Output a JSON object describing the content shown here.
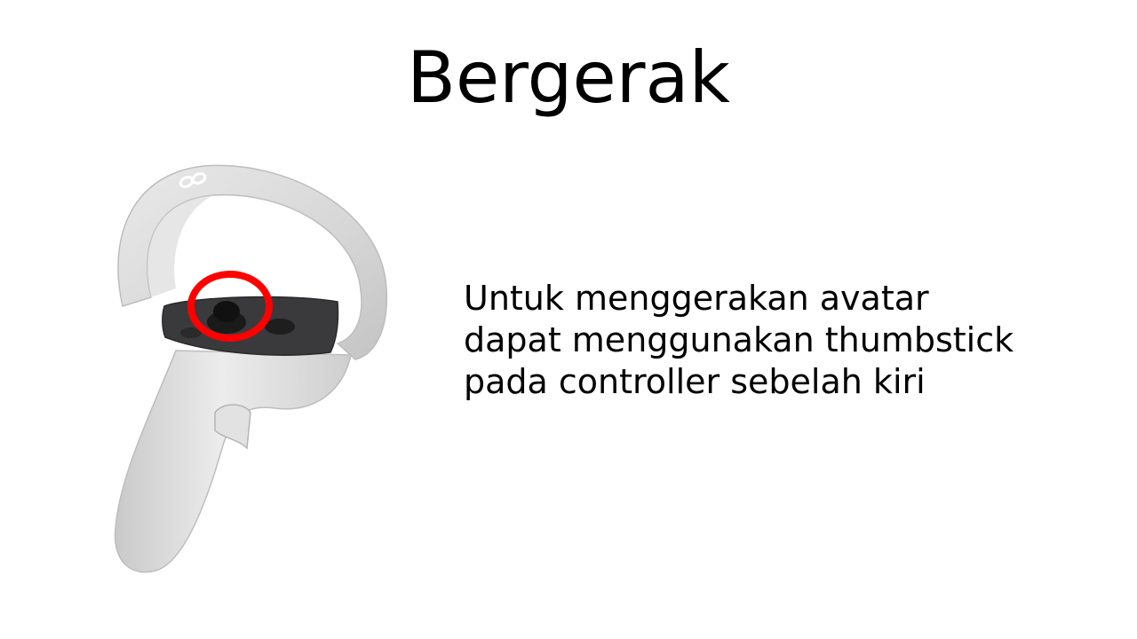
{
  "slide": {
    "title": "Bergerak",
    "body_lines": [
      "Untuk menggerakan avatar",
      "dapat menggunakan thumbstick",
      "pada controller sebelah kiri"
    ],
    "image": {
      "icon": "vr-left-controller-icon",
      "highlight_icon": "thumbstick-highlight-circle-icon",
      "highlight_color": "#ff0000"
    }
  }
}
